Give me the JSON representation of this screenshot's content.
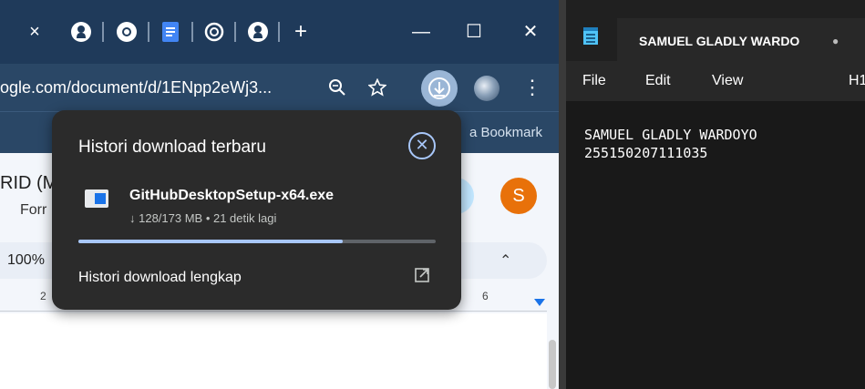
{
  "chrome": {
    "tabs": [
      {
        "icon": "github-icon"
      },
      {
        "icon": "chrome-icon"
      },
      {
        "icon": "google-docs-icon"
      },
      {
        "icon": "chatgpt-icon"
      },
      {
        "icon": "github-icon"
      }
    ],
    "tab_close_symbol": "×",
    "new_tab_symbol": "+",
    "window_controls": {
      "minimize": "—",
      "maximize": "☐",
      "close": "✕"
    },
    "url": "ogle.com/document/d/1ENpp2eWj3...",
    "bookmark_label": "a Bookmark",
    "doc": {
      "title": "RID (M",
      "subtitle": "Forr",
      "avatar_letter": "S",
      "zoom": "100%",
      "ruler_marks": [
        "2",
        "6"
      ]
    },
    "download_popup": {
      "title": "Histori download terbaru",
      "file_name": "GitHubDesktopSetup-x64.exe",
      "status": "↓ 128/173 MB • 21 detik lagi",
      "progress_fraction": 0.74,
      "full_history_label": "Histori download lengkap"
    }
  },
  "notepad": {
    "tab_title": "SAMUEL GLADLY WARDO",
    "unsaved_dot": "●",
    "menu": {
      "file": "File",
      "edit": "Edit",
      "view": "View",
      "heading": "H1"
    },
    "content": "SAMUEL GLADLY WARDOYO\n255150207111035"
  },
  "colors": {
    "chrome_frame": "#1f3a5a",
    "popup_bg": "#2b2b2b",
    "progress": "#a8c7fa",
    "avatar": "#e8710a",
    "notepad_bg": "#191919"
  }
}
